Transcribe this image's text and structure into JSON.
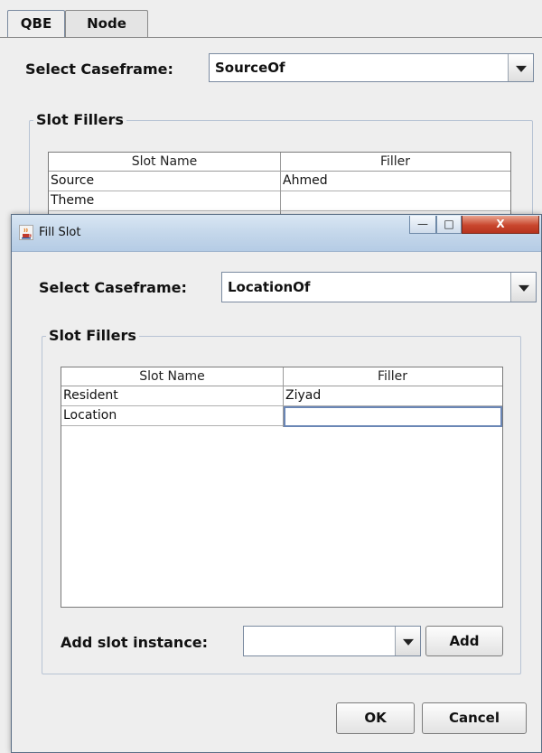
{
  "background": {
    "tabs": [
      {
        "label": "QBE"
      },
      {
        "label": "Node"
      }
    ],
    "caseframe_label": "Select Caseframe:",
    "caseframe_value": "SourceOf",
    "slot_fillers_title": "Slot Fillers",
    "table": {
      "headers": [
        "Slot Name",
        "Filler"
      ],
      "rows": [
        {
          "slot": "Source",
          "filler": "Ahmed"
        },
        {
          "slot": "Theme",
          "filler": ""
        }
      ]
    }
  },
  "dialog": {
    "title": "Fill Slot",
    "window_buttons": {
      "minimize": "—",
      "maximize": "□",
      "close": "X"
    },
    "caseframe_label": "Select Caseframe:",
    "caseframe_value": "LocationOf",
    "slot_fillers_title": "Slot Fillers",
    "table": {
      "headers": [
        "Slot Name",
        "Filler"
      ],
      "rows": [
        {
          "slot": "Resident",
          "filler": "Ziyad"
        },
        {
          "slot": "Location",
          "filler": ""
        }
      ]
    },
    "add_slot_label": "Add slot instance:",
    "add_slot_value": "",
    "add_button": "Add",
    "ok_button": "OK",
    "cancel_button": "Cancel"
  },
  "icons": {
    "app": "java-cup-icon",
    "dropdown": "chevron-down-icon"
  },
  "colors": {
    "window_bg": "#eeeeee",
    "titlebar": "#c3d6ea",
    "close_button": "#c9472e",
    "group_border": "#b7c3d4"
  }
}
